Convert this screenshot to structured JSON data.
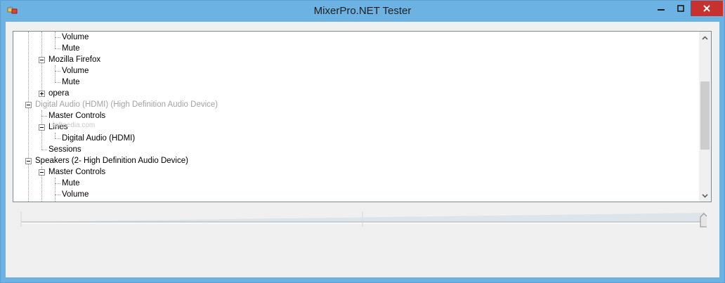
{
  "window": {
    "title": "MixerPro.NET Tester"
  },
  "tree": {
    "nodes": [
      {
        "label": "Volume"
      },
      {
        "label": "Mute"
      },
      {
        "label": "Mozilla Firefox"
      },
      {
        "label": "Volume"
      },
      {
        "label": "Mute"
      },
      {
        "label": "opera"
      },
      {
        "label": "Digital Audio (HDMI) (High Definition Audio Device)"
      },
      {
        "label": "Master Controls"
      },
      {
        "label": "Lines"
      },
      {
        "label": "Digital Audio (HDMI)"
      },
      {
        "label": "Sessions"
      },
      {
        "label": "Speakers (2- High Definition Audio Device)"
      },
      {
        "label": "Master Controls"
      },
      {
        "label": "Mute"
      },
      {
        "label": "Volume"
      }
    ],
    "watermark": "softpedia.com"
  },
  "slider": {
    "value_percent": 100
  },
  "colors": {
    "titlebar": "#6cb2e2",
    "close_button": "#c7312e",
    "client": "#f0f0f0"
  }
}
